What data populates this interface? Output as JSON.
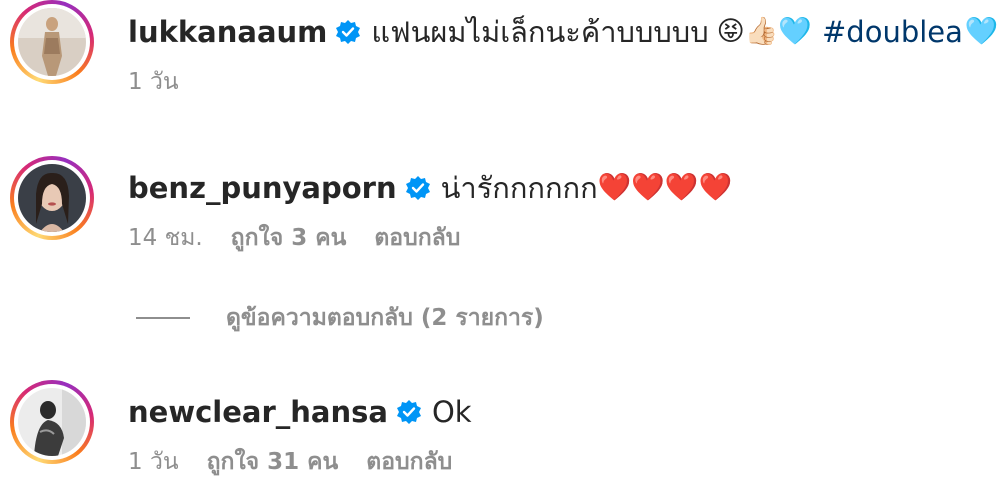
{
  "comments": [
    {
      "username": "lukkanaaum",
      "text": "แฟนผมไม่เล็กนะค้าบบบบบ",
      "emoji": "😝👍🏻🩵",
      "hashtag": "#doublea",
      "hashtag_emoji": "🩵",
      "time": "1 วัน",
      "likes": "",
      "reply": ""
    },
    {
      "username": "benz_punyaporn",
      "text": "น่ารักกกกกก",
      "emoji": "❤️❤️❤️❤️",
      "time": "14 ชม.",
      "likes": "ถูกใจ 3 คน",
      "reply": "ตอบกลับ"
    },
    {
      "username": "newclear_hansa",
      "text": "Ok",
      "time": "1 วัน",
      "likes": "ถูกใจ 31 คน",
      "reply": "ตอบกลับ"
    }
  ],
  "view_replies": "ดูข้อความตอบกลับ (2 รายการ)",
  "colors": {
    "text": "#262626",
    "secondary": "#8e8e8e",
    "hashtag": "#00376b",
    "verified": "#0095f6"
  },
  "icons": {
    "verified": "verified-badge-icon"
  }
}
